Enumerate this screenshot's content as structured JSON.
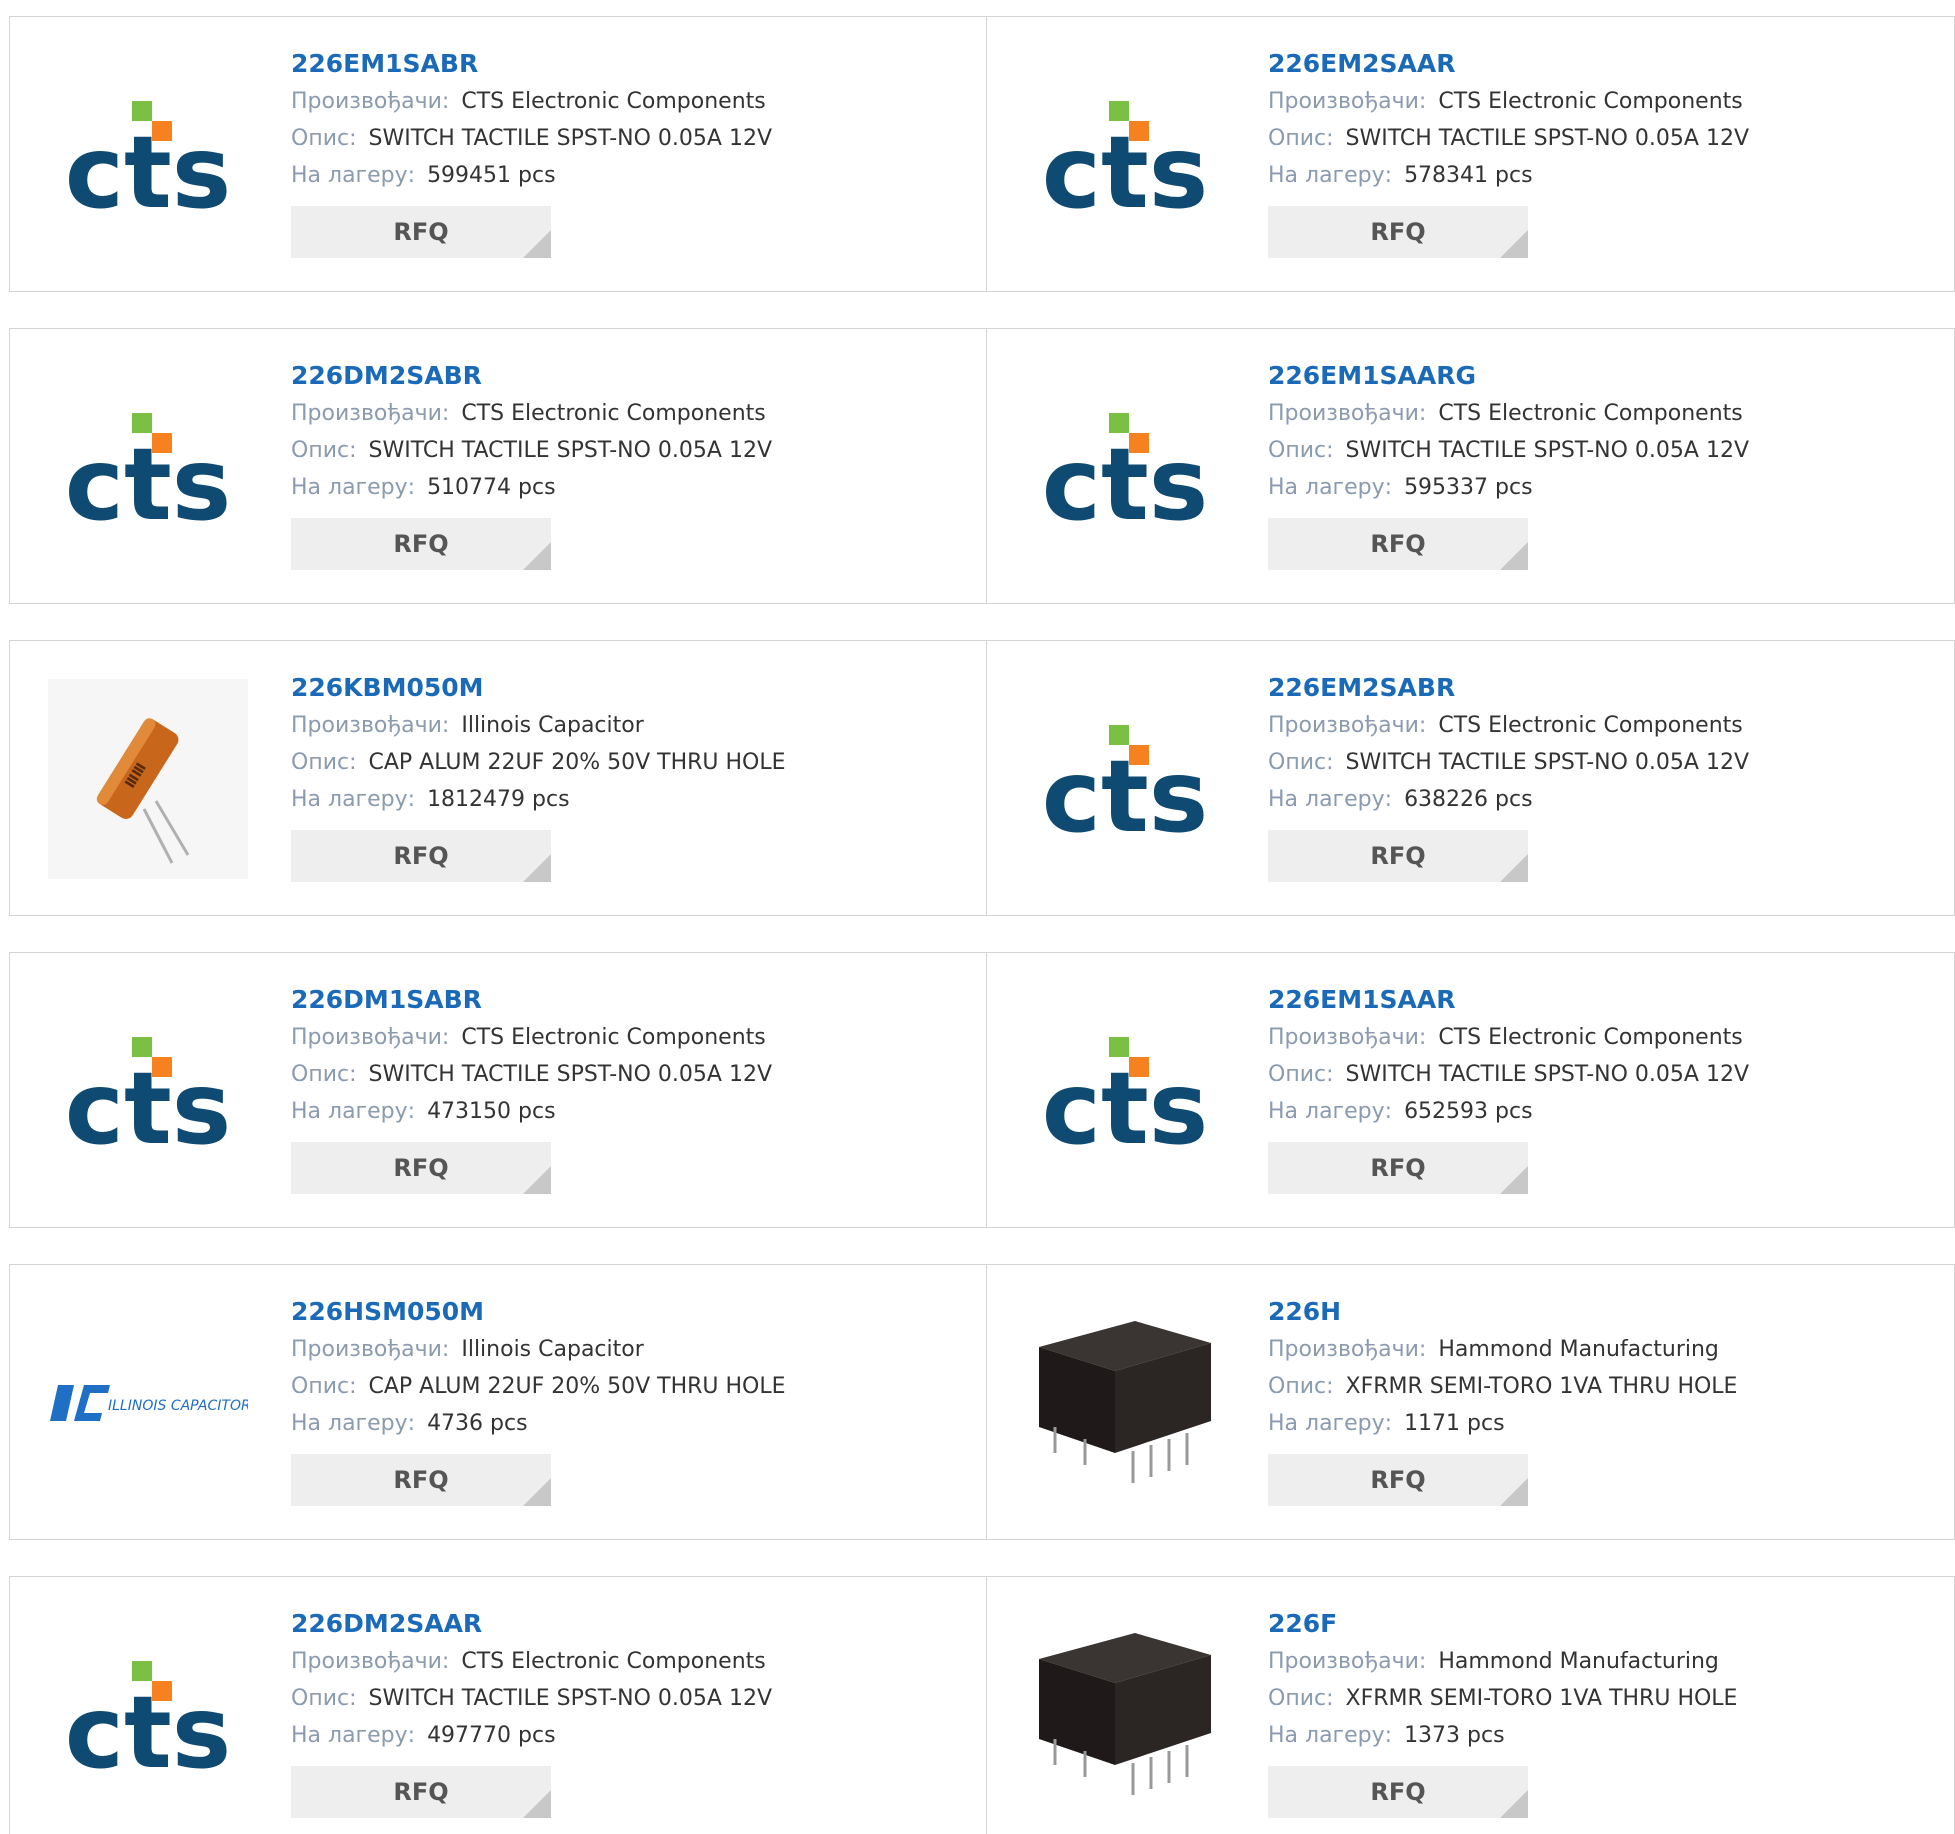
{
  "labels": {
    "manufacturer": "Произвођачи:",
    "description": "Опис:",
    "stock": "На лагеру:",
    "rfq": "RFQ"
  },
  "products": [
    {
      "pn": "226EM1SABR",
      "manufacturer": "CTS Electronic Components",
      "description": "SWITCH TACTILE SPST-NO 0.05A 12V",
      "stock": "599451 pcs",
      "image": "cts-logo"
    },
    {
      "pn": "226EM2SAAR",
      "manufacturer": "CTS Electronic Components",
      "description": "SWITCH TACTILE SPST-NO 0.05A 12V",
      "stock": "578341 pcs",
      "image": "cts-logo"
    },
    {
      "pn": "226DM2SABR",
      "manufacturer": "CTS Electronic Components",
      "description": "SWITCH TACTILE SPST-NO 0.05A 12V",
      "stock": "510774 pcs",
      "image": "cts-logo"
    },
    {
      "pn": "226EM1SAARG",
      "manufacturer": "CTS Electronic Components",
      "description": "SWITCH TACTILE SPST-NO 0.05A 12V",
      "stock": "595337 pcs",
      "image": "cts-logo"
    },
    {
      "pn": "226KBM050M",
      "manufacturer": "Illinois Capacitor",
      "description": "CAP ALUM 22UF 20% 50V THRU HOLE",
      "stock": "1812479 pcs",
      "image": "capacitor-photo"
    },
    {
      "pn": "226EM2SABR",
      "manufacturer": "CTS Electronic Components",
      "description": "SWITCH TACTILE SPST-NO 0.05A 12V",
      "stock": "638226 pcs",
      "image": "cts-logo"
    },
    {
      "pn": "226DM1SABR",
      "manufacturer": "CTS Electronic Components",
      "description": "SWITCH TACTILE SPST-NO 0.05A 12V",
      "stock": "473150 pcs",
      "image": "cts-logo"
    },
    {
      "pn": "226EM1SAAR",
      "manufacturer": "CTS Electronic Components",
      "description": "SWITCH TACTILE SPST-NO 0.05A 12V",
      "stock": "652593 pcs",
      "image": "cts-logo"
    },
    {
      "pn": "226HSM050M",
      "manufacturer": "Illinois Capacitor",
      "description": "CAP ALUM 22UF 20% 50V THRU HOLE",
      "stock": "4736 pcs",
      "image": "illinois-capacitor-logo",
      "logo_text": "ILLINOIS CAPACITOR, INC."
    },
    {
      "pn": "226H",
      "manufacturer": "Hammond Manufacturing",
      "description": "XFRMR SEMI-TORO 1VA THRU HOLE",
      "stock": "1171 pcs",
      "image": "transformer-photo"
    },
    {
      "pn": "226DM2SAAR",
      "manufacturer": "CTS Electronic Components",
      "description": "SWITCH TACTILE SPST-NO 0.05A 12V",
      "stock": "497770 pcs",
      "image": "cts-logo"
    },
    {
      "pn": "226F",
      "manufacturer": "Hammond Manufacturing",
      "description": "XFRMR SEMI-TORO 1VA THRU HOLE",
      "stock": "1373 pcs",
      "image": "transformer-photo"
    }
  ],
  "colors": {
    "link": "#1a6ab8",
    "label": "#8a9bb0",
    "cts_blue": "#0e4a72",
    "cts_green": "#7ac143",
    "cts_orange": "#f5821f",
    "ic_blue": "#1f6fc4"
  }
}
